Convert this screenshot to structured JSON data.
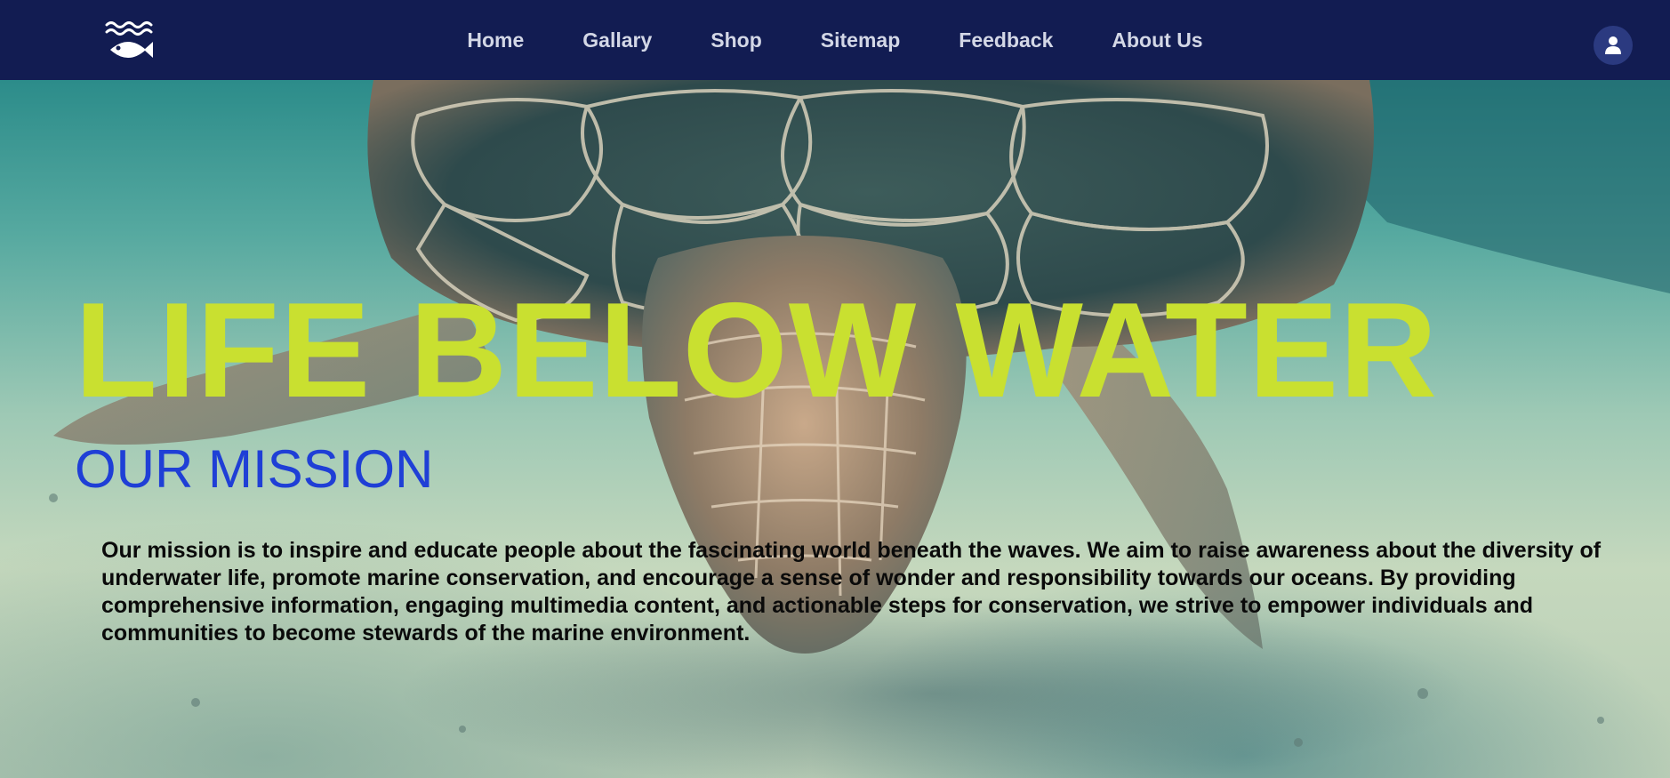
{
  "nav": {
    "logo_icon": "fish-waves-icon",
    "links": [
      {
        "label": "Home"
      },
      {
        "label": "Gallary"
      },
      {
        "label": "Shop"
      },
      {
        "label": "Sitemap"
      },
      {
        "label": "Feedback"
      },
      {
        "label": "About Us"
      }
    ],
    "user_icon": "user-icon"
  },
  "hero": {
    "title": "LIFE BELOW WATER",
    "mission_heading": "OUR MISSION",
    "mission_text": "Our mission is to inspire and educate people about the fascinating world beneath the waves. We aim to raise awareness about the diversity of underwater life, promote marine conservation, and encourage a sense of wonder and responsibility towards our oceans. By providing comprehensive information, engaging multimedia content, and actionable steps for conservation, we strive to empower individuals and communities to become stewards of the marine environment.",
    "background_image": "sea-turtle-photo"
  },
  "colors": {
    "navbar": "#121c52",
    "nav_text": "#d3d7e6",
    "title": "#c9e030",
    "mission_heading": "#1f3fd6",
    "body_text": "#0a0a0a"
  }
}
